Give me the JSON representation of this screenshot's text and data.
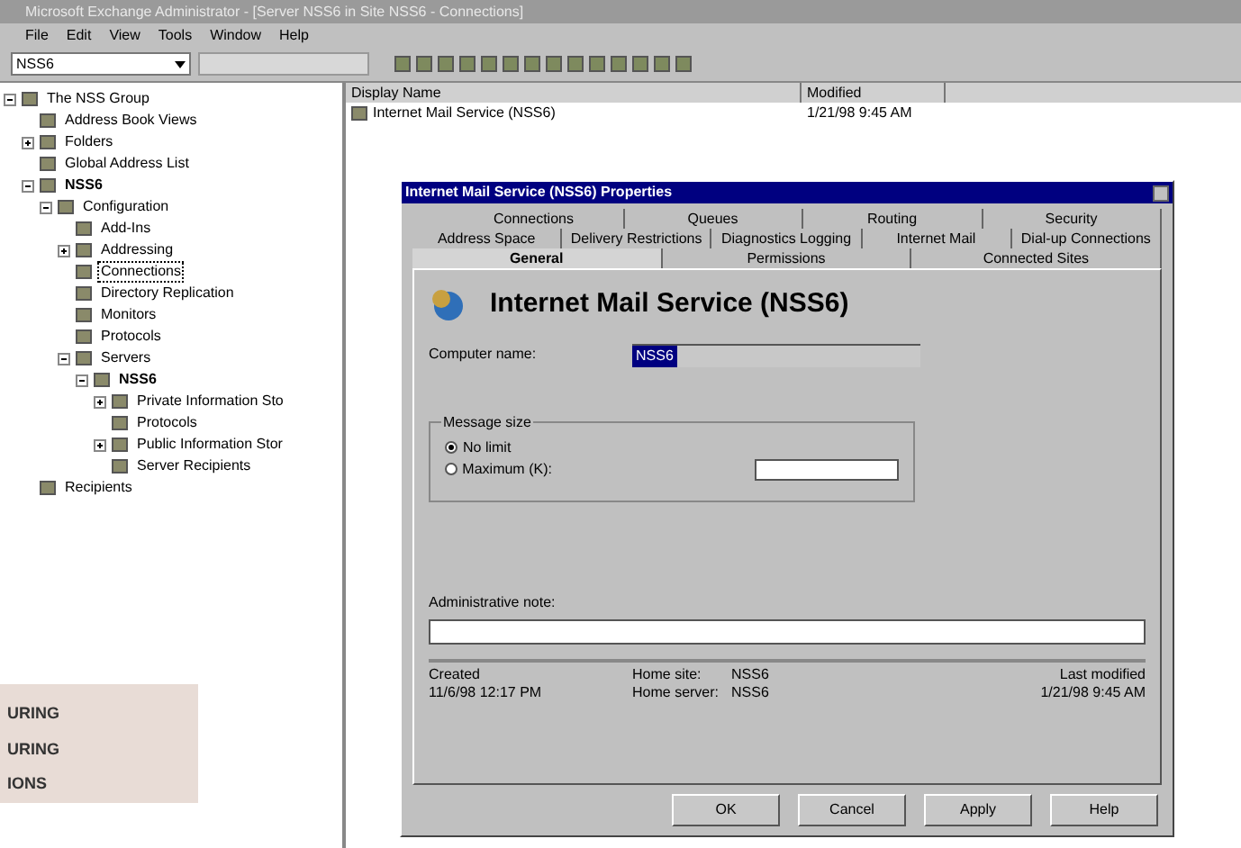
{
  "window": {
    "title": "Microsoft Exchange Administrator - [Server NSS6 in Site NSS6 - Connections]"
  },
  "menu": [
    "File",
    "Edit",
    "View",
    "Tools",
    "Window",
    "Help"
  ],
  "toolbar": {
    "server_combo": "NSS6"
  },
  "tree": [
    {
      "label": "The NSS Group",
      "expanded": true,
      "selected": false,
      "children": [
        {
          "label": "Address Book Views",
          "selected": false
        },
        {
          "label": "Folders",
          "expanded": false,
          "selected": false
        },
        {
          "label": "Global Address List",
          "selected": false
        },
        {
          "label": "NSS6",
          "bold": true,
          "expanded": true,
          "selected": false,
          "children": [
            {
              "label": "Configuration",
              "expanded": true,
              "selected": false,
              "children": [
                {
                  "label": "Add-Ins",
                  "selected": false
                },
                {
                  "label": "Addressing",
                  "expanded": false,
                  "selected": false
                },
                {
                  "label": "Connections",
                  "selected": true
                },
                {
                  "label": "Directory Replication",
                  "selected": false
                },
                {
                  "label": "Monitors",
                  "selected": false
                },
                {
                  "label": "Protocols",
                  "selected": false
                },
                {
                  "label": "Servers",
                  "expanded": true,
                  "selected": false,
                  "children": [
                    {
                      "label": "NSS6",
                      "bold": true,
                      "expanded": true,
                      "selected": false,
                      "children": [
                        {
                          "label": "Private Information Sto",
                          "expanded": false,
                          "selected": false
                        },
                        {
                          "label": "Protocols",
                          "selected": false
                        },
                        {
                          "label": "Public Information Stor",
                          "expanded": false,
                          "selected": false
                        },
                        {
                          "label": "Server Recipients",
                          "selected": false
                        }
                      ]
                    }
                  ]
                }
              ]
            }
          ]
        },
        {
          "label": "Recipients",
          "selected": false
        }
      ]
    }
  ],
  "list": {
    "columns": [
      "Display Name",
      "Modified"
    ],
    "rows": [
      {
        "name": "Internet Mail Service (NSS6)",
        "modified": "1/21/98 9:45 AM",
        "selected": false
      }
    ]
  },
  "dialog": {
    "title": "Internet Mail Service (NSS6) Properties",
    "tab_rows": [
      [
        {
          "label": "Connections",
          "selected": false
        },
        {
          "label": "Queues",
          "selected": false
        },
        {
          "label": "Routing",
          "selected": false
        },
        {
          "label": "Security",
          "selected": false
        }
      ],
      [
        {
          "label": "Address Space",
          "selected": false
        },
        {
          "label": "Delivery Restrictions",
          "selected": false
        },
        {
          "label": "Diagnostics Logging",
          "selected": false
        },
        {
          "label": "Internet Mail",
          "selected": false
        },
        {
          "label": "Dial-up Connections",
          "selected": false
        }
      ],
      [
        {
          "label": "General",
          "selected": true
        },
        {
          "label": "Permissions",
          "selected": false
        },
        {
          "label": "Connected Sites",
          "selected": false
        }
      ]
    ],
    "heading": "Internet Mail Service (NSS6)",
    "computer_name": {
      "label": "Computer name:",
      "value": "NSS6"
    },
    "message_size": {
      "label": "Message size",
      "options": [
        {
          "label": "No limit",
          "selected": true
        },
        {
          "label": "Maximum (K):",
          "selected": false
        }
      ]
    },
    "admin_note": {
      "label": "Administrative note:"
    },
    "footer": {
      "created_label": "Created",
      "created": "11/6/98 12:17 PM",
      "home_site_label": "Home site:",
      "home_site": "NSS6",
      "home_server_label": "Home server:",
      "home_server": "NSS6",
      "modified_label": "Last modified",
      "modified": "1/21/98 9:45 AM"
    },
    "buttons": [
      "OK",
      "Cancel",
      "Apply",
      "Help"
    ]
  },
  "page_note": {
    "lines": [
      "URING",
      "URING",
      "IONS"
    ]
  }
}
